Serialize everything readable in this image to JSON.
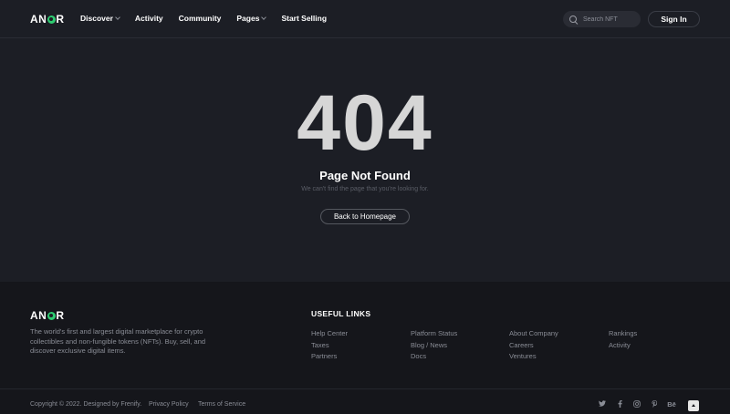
{
  "brand": {
    "logo_prefix": "AN",
    "logo_suffix": "R",
    "accent": "#2ecc71"
  },
  "header": {
    "nav": [
      {
        "label": "Discover",
        "has_dropdown": true
      },
      {
        "label": "Activity",
        "has_dropdown": false
      },
      {
        "label": "Community",
        "has_dropdown": false
      },
      {
        "label": "Pages",
        "has_dropdown": true
      },
      {
        "label": "Start Selling",
        "has_dropdown": false
      }
    ],
    "search_placeholder": "Search NFT",
    "signin_label": "Sign In"
  },
  "main": {
    "code": "404",
    "title": "Page Not Found",
    "subtitle": "We can't find the page that you're looking for.",
    "button_label": "Back to Homepage"
  },
  "footer": {
    "description": "The world's first and largest digital marketplace for crypto collectibles and non-fungible tokens (NFTs). Buy, sell, and discover exclusive digital items.",
    "links_title": "USEFUL LINKS",
    "link_columns": [
      [
        "Help Center",
        "Taxes",
        "Partners"
      ],
      [
        "Platform Status",
        "Blog / News",
        "Docs"
      ],
      [
        "About Company",
        "Careers",
        "Ventures"
      ],
      [
        "Rankings",
        "Activity"
      ]
    ],
    "copyright": "Copyright © 2022. Designed by Frenify.",
    "privacy_label": "Privacy Policy",
    "terms_label": "Terms of Service",
    "social_icons": [
      "twitter-icon",
      "facebook-icon",
      "instagram-icon",
      "pinterest-icon",
      "behance-icon"
    ],
    "behance_text": "Bē"
  }
}
